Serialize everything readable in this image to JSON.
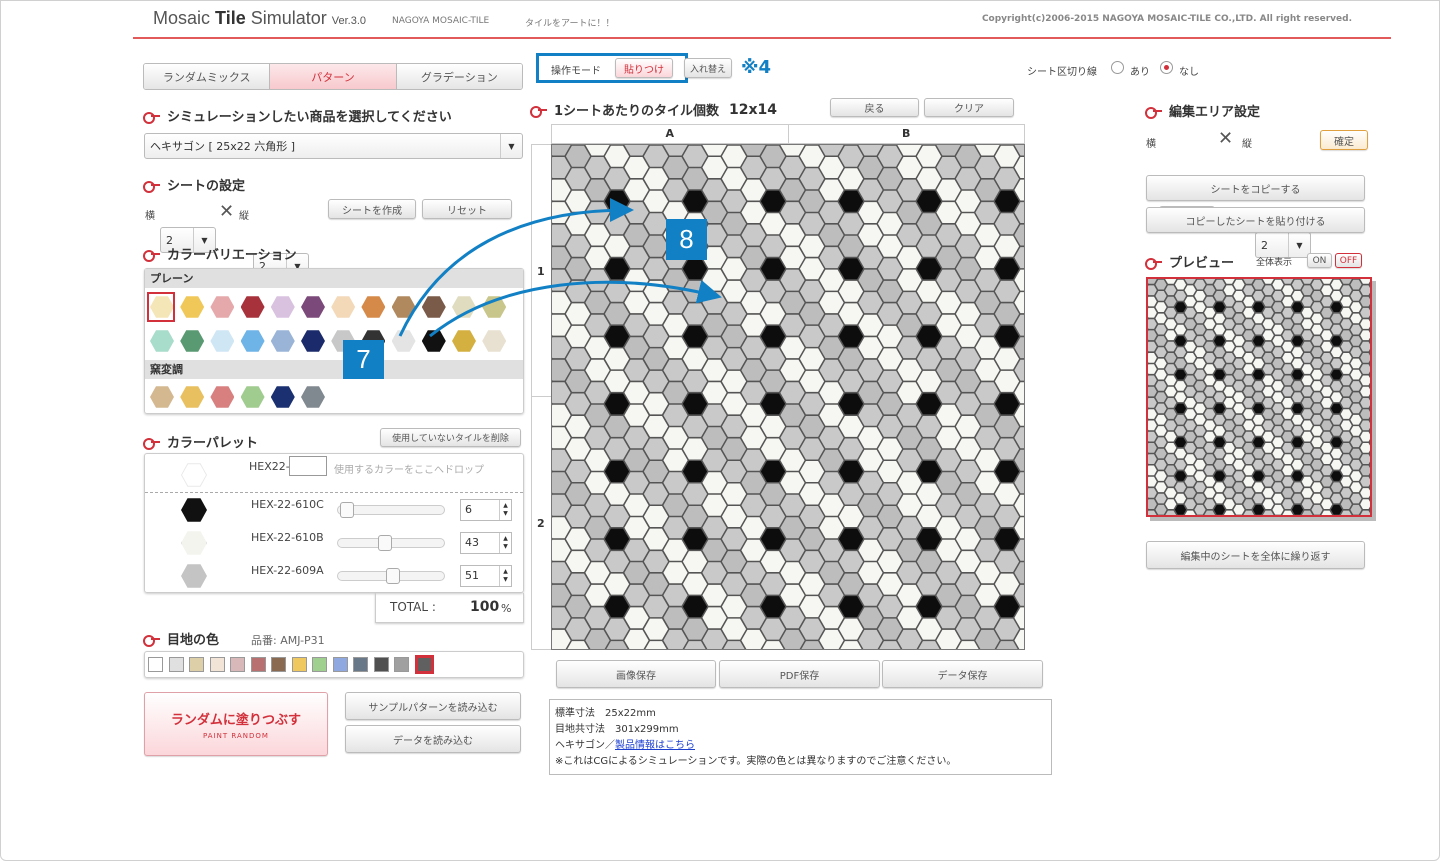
{
  "header": {
    "title_main": "Mosaic",
    "title_bold": "Tile",
    "title_rest": "Simulator",
    "version": "Ver.3.0",
    "company": "NAGOYA MOSAIC-TILE",
    "tagline": "タイルをアートに！！",
    "copyright": "Copyright(c)2006-2015 NAGOYA MOSAIC-TILE CO.,LTD. All right reserved."
  },
  "tabs": [
    "ランダムミックス",
    "パターン",
    "グラデーション"
  ],
  "product": {
    "heading": "シミュレーションしたい商品を選択してください",
    "selected": "ヘキサゴン [ 25x22 六角形 ]"
  },
  "sheet": {
    "heading": "シートの設定",
    "yoko_label": "横",
    "yoko_value": "2",
    "tate_label": "縦",
    "tate_value": "2",
    "create": "シートを作成",
    "reset": "リセット"
  },
  "variation": {
    "heading": "カラーバリエーション",
    "plain_label": "プレーン",
    "kiln_label": "窯変調",
    "plain_row1": [
      "#f5e6b8",
      "#f0c85a",
      "#e6a9ab",
      "#a8323b",
      "#d9c2e0",
      "#7b4a7a",
      "#f3d9b8",
      "#d68a4a",
      "#b08a5e",
      "#7a5a48",
      "#e0dcc0",
      "#c8c68a"
    ],
    "plain_row2": [
      "#a8dccb",
      "#5a9a72",
      "#cfe6f5",
      "#6eb4e6",
      "#9ab4d8",
      "#1a2a6a",
      "#c8c8c8",
      "#333333",
      "#ffffff",
      "#111111",
      "#d4b040",
      "#e8e0d0"
    ],
    "kiln_row": [
      "#d4b890",
      "#e8c060",
      "#d88080",
      "#a0cc90",
      "#1a3070",
      "#808890"
    ]
  },
  "palette": {
    "heading": "カラーパレット",
    "delete_unused": "使用していないタイルを削除",
    "drop_code_label": "HEX22-",
    "drop_hint": "使用するカラーをここへドロップ",
    "items": [
      {
        "code": "HEX-22-610C",
        "value": "6",
        "color": "#111111",
        "slider": 0.02
      },
      {
        "code": "HEX-22-610B",
        "value": "43",
        "color": "#f8f8f4",
        "slider": 0.43
      },
      {
        "code": "HEX-22-609A",
        "value": "51",
        "color": "#c4c4c4",
        "slider": 0.51
      }
    ],
    "total_label": "TOTAL :",
    "total_value": "100",
    "total_unit": "%"
  },
  "joint": {
    "heading": "目地の色",
    "code": "品番: AMJ-P31",
    "colors": [
      "#ffffff",
      "#e0e0e0",
      "#ddd0a8",
      "#f3e4d8",
      "#d8b8b8",
      "#b87070",
      "#8a6a50",
      "#f0c860",
      "#a0d090",
      "#90a8e0",
      "#687888",
      "#505050",
      "#a0a0a0",
      "#606060"
    ]
  },
  "actions": {
    "paint_random": "ランダムに塗りつぶす",
    "paint_random_en": "PAINT RANDOM",
    "load_sample": "サンプルパターンを読み込む",
    "load_data": "データを読み込む"
  },
  "mode": {
    "label": "操作モード",
    "paste": "貼りつけ",
    "swap": "入れ替え",
    "note": "※4"
  },
  "separator": {
    "label": "シート区切り線",
    "on": "あり",
    "off": "なし"
  },
  "grid": {
    "heading": "1シートあたりのタイル個数",
    "count": "12x14",
    "back": "戻る",
    "clear": "クリア",
    "col_a": "A",
    "col_b": "B",
    "row_1": "1",
    "row_2": "2"
  },
  "save": {
    "image": "画像保存",
    "pdf": "PDF保存",
    "data": "データ保存"
  },
  "info": {
    "size": "標準寸法　25x22mm",
    "joint_size": "目地共寸法　301x299mm",
    "product_prefix": "ヘキサゴン／",
    "product_link": "製品情報はこちら",
    "note": "※これはCGによるシミュレーションです。実際の色とは異なりますのでご注意ください。"
  },
  "edit_area": {
    "heading": "編集エリア設定",
    "yoko_label": "横",
    "yoko_value": "2",
    "tate_label": "縦",
    "tate_value": "2",
    "confirm": "確定",
    "copy_sheet": "シートをコピーする",
    "paste_sheet": "コピーしたシートを貼り付ける"
  },
  "preview": {
    "heading": "プレビュー",
    "show_all": "全体表示",
    "on": "ON",
    "off": "OFF",
    "repeat": "編集中のシートを全体に繰り返す"
  },
  "callouts": [
    "7",
    "8"
  ],
  "colors": {
    "accent": "#d2303a",
    "callout": "#1280c4"
  }
}
